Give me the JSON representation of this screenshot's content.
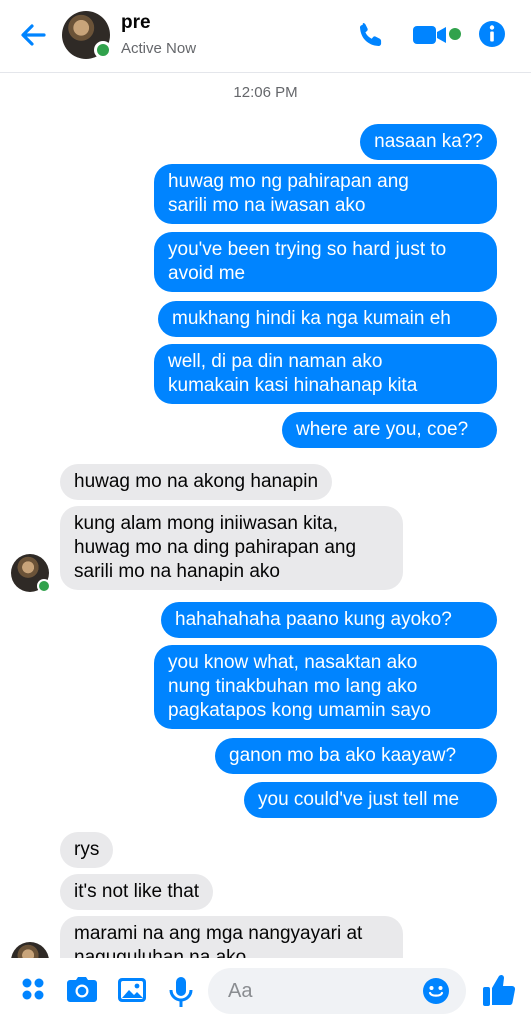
{
  "header": {
    "contact_name": "pre",
    "status": "Active Now"
  },
  "timestamp": "12:06 PM",
  "messages": [
    {
      "from": "me",
      "text": "nasaan ka??"
    },
    {
      "from": "me",
      "text": "huwag mo ng pahirapan ang\nsarili mo na iwasan ako"
    },
    {
      "from": "me",
      "text": "you've been trying so hard just to\navoid me"
    },
    {
      "from": "me",
      "text": "mukhang hindi ka nga kumain eh"
    },
    {
      "from": "me",
      "text": "well, di pa din naman ako\nkumakain kasi hinahanap kita"
    },
    {
      "from": "me",
      "text": "where are you, coe?"
    },
    {
      "from": "them",
      "text": "huwag mo na akong hanapin"
    },
    {
      "from": "them",
      "text": "kung alam mong iniiwasan kita,\nhuwag mo na ding pahirapan ang\nsarili mo na hanapin ako"
    },
    {
      "from": "me",
      "text": "hahahahaha paano kung ayoko?"
    },
    {
      "from": "me",
      "text": "you know what, nasaktan ako\nnung tinakbuhan mo lang ako\npagkatapos kong umamin sayo"
    },
    {
      "from": "me",
      "text": "ganon mo ba ako kaayaw?"
    },
    {
      "from": "me",
      "text": "you could've just tell me"
    },
    {
      "from": "them",
      "text": "rys"
    },
    {
      "from": "them",
      "text": "it's not like that"
    },
    {
      "from": "them",
      "text": "marami na ang mga nangyayari at\nnaguguluhan na ako"
    }
  ],
  "composer": {
    "placeholder": "Aa"
  },
  "colors": {
    "accent": "#0084ff",
    "online": "#31a24c",
    "incoming_bubble": "#e9e9eb"
  }
}
